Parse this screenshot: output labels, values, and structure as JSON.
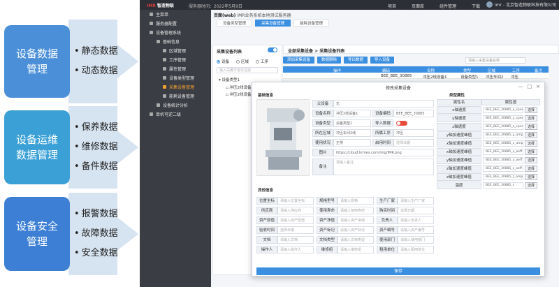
{
  "infographic": {
    "blocks": [
      {
        "title": "设备数据\n管理",
        "color": "#4a8fd8",
        "items": [
          "静态数据",
          "动态数据"
        ]
      },
      {
        "title": "设备运维\n数据管理",
        "color": "#3aa0d6",
        "items": [
          "保养数据",
          "维修数据",
          "备件数据"
        ]
      },
      {
        "title": "设备安全\n管理",
        "color": "#3c7fd4",
        "items": [
          "报警数据",
          "故障数据",
          "安全数据"
        ]
      }
    ]
  },
  "topbar": {
    "logo_prefix": "IMR",
    "logo_text": "智造物联",
    "server_time": "服务器时间：2022年5月9日",
    "nav": [
      "项目",
      "页面库",
      "组件管理",
      "下载"
    ],
    "user": "imr - 北京智造物联科技有限公司"
  },
  "sidebar": {
    "items": [
      {
        "label": "主菜单",
        "level": 0
      },
      {
        "label": "服务器配置",
        "level": 0
      },
      {
        "label": "设备管理系统",
        "level": 0
      },
      {
        "label": "基础信息",
        "level": 1
      },
      {
        "label": "区域管理",
        "level": 2
      },
      {
        "label": "工序管理",
        "level": 2
      },
      {
        "label": "属性管理",
        "level": 2
      },
      {
        "label": "设备类型管理",
        "level": 2
      },
      {
        "label": "采集设备管理",
        "level": 2
      },
      {
        "label": "能耗设备管理",
        "level": 2
      },
      {
        "label": "设备统计分析",
        "level": 1
      },
      {
        "label": "单机可逆二级",
        "level": 0
      }
    ],
    "active_index": 8
  },
  "breadcrumb": {
    "main": "页面(web)",
    "sub": "IMR业务系统本地测试服务器"
  },
  "tabs": [
    "设备类型管理",
    "采集设备管理",
    "能耗设备管理"
  ],
  "tree": {
    "title": "采集设备列表",
    "radios": [
      "设备",
      "区域",
      "工序"
    ],
    "search_placeholder": "输入关键字进行过滤",
    "nodes": [
      "设备类型1",
      "冲压2线设备1",
      "冲压2线设备2"
    ]
  },
  "content": {
    "title": "全部采集设备 > 采集设备列表",
    "toolbar": [
      "添加采集设备",
      "数据删除",
      "导出数据",
      "导入设备"
    ],
    "search_placeholder": "请输入采集设备名称",
    "columns": [
      "操作",
      "编码",
      "名称",
      "类型",
      "区域",
      "工序",
      "备注"
    ],
    "row": [
      "",
      "BEE_BEE_30885",
      "冲压2线设备1",
      "设备类型1",
      "冲压车间2",
      "冲压",
      ""
    ]
  },
  "modal": {
    "title": "修改采集设备",
    "controls": [
      "—",
      "□",
      "×"
    ],
    "basic_title": "基础信息",
    "other_title": "其他信息",
    "attr_title": "类型属性",
    "fields": {
      "parent_label": "父设备",
      "parent_value": "无",
      "name_label": "设备名称",
      "name_value": "冲压2线设备1",
      "code_label": "设备编码",
      "code_value": "BEE_BEE_30885",
      "type_label": "设备类型",
      "type_value": "设备类型1",
      "import_label": "导入数据",
      "area_label": "所在区域",
      "area_value": "冲压车间2线",
      "proc_label": "所属工序",
      "proc_value": "冲压",
      "status_label": "使用状况",
      "status_value": "正常",
      "start_label": "启用时间",
      "start_value": "选择日期",
      "pic_label": "图片",
      "pic_value": "https://cloud.krmes.com/img/IMR.png",
      "note_label": "备注",
      "note_value": "请输入备注"
    },
    "other": [
      [
        "位置坐标",
        "请输入位置坐标",
        "规格型号",
        "请输入规格",
        "生产厂家",
        "请输入生产厂家"
      ],
      [
        "供应商",
        "请输入供应商",
        "使用寿命",
        "请输入使用寿命",
        "购买时间",
        "选择日期"
      ],
      [
        "资产原值",
        "请输入资产原值",
        "资产净值",
        "请输入资产净值",
        "负责人",
        "请输入负责人"
      ],
      [
        "验收时间",
        "选择日期",
        "资产标记",
        "请输入资产标记",
        "资产编号",
        "请输入资产编号"
      ],
      [
        "文档",
        "请输入文档",
        "文档类型",
        "请输入文档类型",
        "使用部门",
        "请输入使用部门"
      ],
      [
        "操作人",
        "请输入操作人",
        "维修组",
        "请输入维修组",
        "租用单位",
        "请输入租用单位"
      ]
    ],
    "attr_head": [
      "属性名",
      "属性值"
    ],
    "attrs": [
      [
        "x轴速度",
        "BEE_BEE_30885_x_speed"
      ],
      [
        "y轴速度",
        "BEE_BEE_30885_y_speed"
      ],
      [
        "z轴速度",
        "BEE_BEE_30885_z_speed"
      ],
      [
        "y轴加速度峰值",
        "BEE_BEE_30885_y_ampl"
      ],
      [
        "x轴加速度峰值",
        "BEE_BEE_30885_x_ampl"
      ],
      [
        "x轴加速度峰值",
        "BEE_BEE_30885_x_aeff"
      ],
      [
        "y轴加速度峰值",
        "BEE_BEE_30885_y_aeff"
      ],
      [
        "z轴加速度峰值",
        "BEE_BEE_30885_z_aeff"
      ],
      [
        "z轴加速度峰值",
        "BEE_BEE_30885_z_ampl"
      ],
      [
        "温度",
        "BEE_BEE_30885_t"
      ]
    ],
    "select_label": "选择",
    "save_label": "保存"
  }
}
